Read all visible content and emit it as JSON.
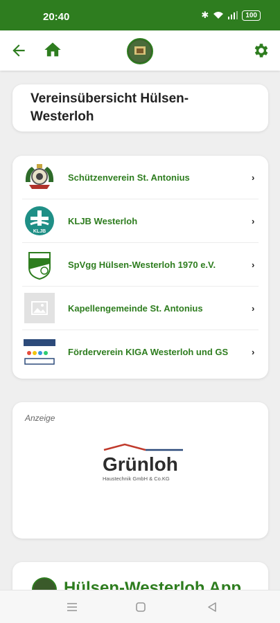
{
  "status_bar": {
    "time": "20:40",
    "battery": "100",
    "icons": [
      "bluetooth-icon",
      "wifi-icon",
      "signal-icon",
      "battery-icon"
    ]
  },
  "app_bar": {
    "icons": [
      "back-arrow-icon",
      "home-icon",
      "club-logo",
      "settings-gear-icon"
    ]
  },
  "title": "Vereinsübersicht Hülsen-Westerloh",
  "clubs": [
    {
      "name": "Schützenverein St. Antonius",
      "icon": "schuetzenverein-logo"
    },
    {
      "name": "KLJB Westerloh",
      "icon": "kljb-logo"
    },
    {
      "name": "SpVgg Hülsen-Westerloh 1970 e.V.",
      "icon": "spvgg-logo"
    },
    {
      "name": "Kapellengemeinde St. Antonius",
      "icon": "image-placeholder-icon"
    },
    {
      "name": "Förderverein KIGA Westerloh und GS",
      "icon": "foerderverein-logo"
    }
  ],
  "ad": {
    "label": "Anzeige",
    "brand": "Grünloh",
    "tagline": "Haustechnik GmbH & Co.KG"
  },
  "promo": {
    "title": "Hülsen-Westerloh App"
  },
  "colors": {
    "primary": "#2e7d1f",
    "background": "#efefef",
    "card": "#ffffff",
    "ad_red": "#c0392b",
    "ad_blue": "#2c4a7a"
  }
}
